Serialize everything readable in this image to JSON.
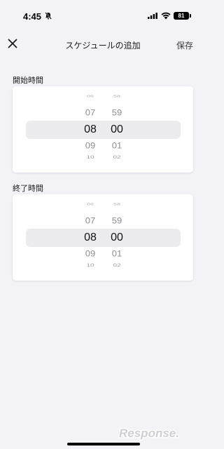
{
  "status_bar": {
    "time": "4:45",
    "battery": "81",
    "icons": [
      "bell-off-icon",
      "signal-icon",
      "wifi-icon",
      "battery-icon"
    ]
  },
  "nav": {
    "close_icon": "close-icon",
    "title": "スケジュールの追加",
    "save_label": "保存"
  },
  "start": {
    "label": "開始時間",
    "hours": [
      "06",
      "07",
      "08",
      "09",
      "10"
    ],
    "minutes": [
      "58",
      "59",
      "00",
      "01",
      "02"
    ],
    "selected_hour": "08",
    "selected_minute": "00"
  },
  "end": {
    "label": "終了時間",
    "hours": [
      "06",
      "07",
      "08",
      "09",
      "10"
    ],
    "minutes": [
      "58",
      "59",
      "00",
      "01",
      "02"
    ],
    "selected_hour": "08",
    "selected_minute": "00"
  },
  "watermark": {
    "text": "Response."
  }
}
